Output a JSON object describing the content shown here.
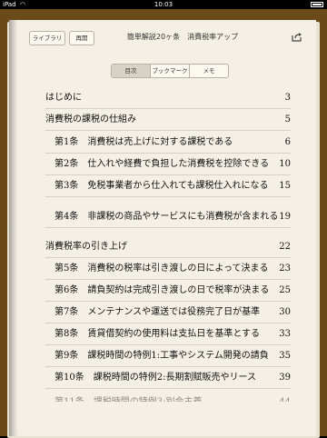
{
  "status_bar": {
    "carrier": "iPad",
    "time": "10:03"
  },
  "toolbar": {
    "library_label": "ライブラリ",
    "resume_label": "再開",
    "book_title": "簡単解説20ヶ条　消費税率アップ",
    "share_icon": "share-icon"
  },
  "segments": [
    {
      "label": "目次",
      "active": true
    },
    {
      "label": "ブックマーク",
      "active": false
    },
    {
      "label": "メモ",
      "active": false
    }
  ],
  "toc": [
    {
      "label": "はじめに",
      "page": "3",
      "sub": false
    },
    {
      "label": "消費税の課税の仕組み",
      "page": "5",
      "sub": false
    },
    {
      "label": "第1条　消費税は売上げに対する課税である",
      "page": "6",
      "sub": true
    },
    {
      "label": "第2条　仕入れや経費で負担した消費税を控除できる",
      "page": "10",
      "sub": true
    },
    {
      "label": "第3条　免税事業者から仕入れても課税仕入れになる",
      "page": "15",
      "sub": true
    },
    {
      "label": "第4条　非課税の商品やサービスにも消費税が含まれる",
      "page": "19",
      "sub": true
    },
    {
      "label": "消費税率の引き上げ",
      "page": "22",
      "sub": false
    },
    {
      "label": "第5条　消費税の税率は引き渡しの日によって決まる",
      "page": "23",
      "sub": true
    },
    {
      "label": "第6条　請負契約は完成引き渡しの日で税率が決まる",
      "page": "25",
      "sub": true
    },
    {
      "label": "第7条　メンテナンスや運送では役務完了日が基準",
      "page": "30",
      "sub": true
    },
    {
      "label": "第8条　賃貸借契約の使用料は支払日を基準とする",
      "page": "33",
      "sub": true
    },
    {
      "label": "第9条　課税時間の特例1:工事やシステム開発の請負",
      "page": "35",
      "sub": true
    },
    {
      "label": "第10条　課税時間の特例2:長期割賦販売やリース",
      "page": "39",
      "sub": true
    },
    {
      "label": "第11条　課税時間の特例3:別会主義",
      "page": "44",
      "sub": true
    }
  ]
}
